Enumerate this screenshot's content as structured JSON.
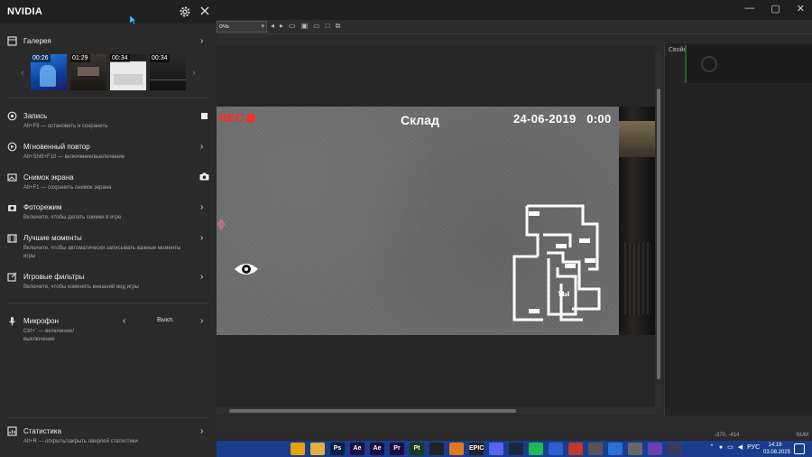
{
  "overlay": {
    "title": "NVIDIA",
    "gallery": {
      "label": "Галерея",
      "thumbnails": [
        "00:26",
        "01:29",
        "00:34",
        "00:34"
      ]
    },
    "record": {
      "label": "Запись",
      "hint": "Alt+F9 — остановить и сохранить"
    },
    "replay": {
      "label": "Мгновенный повтор",
      "hint": "Alt+Shift+F10 — включение/выключение"
    },
    "screenshot": {
      "label": "Снимок экрана",
      "hint": "Alt+F1 — сохранить снимок экрана"
    },
    "photomode": {
      "label": "Фоторежим",
      "hint": "Включите, чтобы делать снимки в игре"
    },
    "highlights": {
      "label": "Лучшие моменты",
      "hint": "Включите, чтобы автоматически записывать важные моменты игры"
    },
    "filters": {
      "label": "Игровые фильтры",
      "hint": "Включите, чтобы изменять внешний вид игры"
    },
    "microphone": {
      "label": "Микрофон",
      "hint": "Ctrl+` — включение/выключение",
      "value": "Выкл."
    },
    "stats": {
      "label": "Статистика",
      "hint": "Alt+R — открыть/закрыть оверлей статистики"
    }
  },
  "game": {
    "rec_label": "REC",
    "location": "Склад",
    "date": "24-06-2019",
    "time": "0:00",
    "map_you_label": "ты"
  },
  "editor": {
    "combo_value": "очь",
    "panel_title": "Свойс",
    "coords": "-370, -414",
    "num": "NUM"
  },
  "taskbar": {
    "lang": "РУС",
    "time": "14:19",
    "date": "03.08.2025",
    "apps": [
      {
        "icon": "chrome-icon",
        "color": "#e8a400",
        "text": ""
      },
      {
        "icon": "folder-icon",
        "color": "#e0b040",
        "text": ""
      },
      {
        "icon": "photoshop-icon",
        "color": "#0d1f3c",
        "text": "Ps"
      },
      {
        "icon": "aftereffects-icon",
        "color": "#1a1040",
        "text": "Ae"
      },
      {
        "icon": "aftereffects2-icon",
        "color": "#1a1040",
        "text": "Ae"
      },
      {
        "icon": "premiere-icon",
        "color": "#1f0f3a",
        "text": "Pr"
      },
      {
        "icon": "pt-icon",
        "color": "#1c3a1c",
        "text": "Pt"
      },
      {
        "icon": "obs-icon",
        "color": "#222",
        "text": ""
      },
      {
        "icon": "blender-icon",
        "color": "#e07a1a",
        "text": ""
      },
      {
        "icon": "epic-icon",
        "color": "#222",
        "text": "EPIC"
      },
      {
        "icon": "discord-icon",
        "color": "#5865f2",
        "text": ""
      },
      {
        "icon": "steam-icon",
        "color": "#1b2838",
        "text": ""
      },
      {
        "icon": "spotify-icon",
        "color": "#1db954",
        "text": ""
      },
      {
        "icon": "browser-icon",
        "color": "#2a5fd0",
        "text": ""
      },
      {
        "icon": "app-red-icon",
        "color": "#c0392b",
        "text": ""
      },
      {
        "icon": "app-grid-icon",
        "color": "#555",
        "text": ""
      },
      {
        "icon": "app-blue-icon",
        "color": "#2d6fd8",
        "text": ""
      },
      {
        "icon": "app-gray-icon",
        "color": "#666",
        "text": ""
      },
      {
        "icon": "app-purple-icon",
        "color": "#6a3fb0",
        "text": ""
      },
      {
        "icon": "app-screen-icon",
        "color": "#3a3a5a",
        "text": ""
      }
    ]
  }
}
